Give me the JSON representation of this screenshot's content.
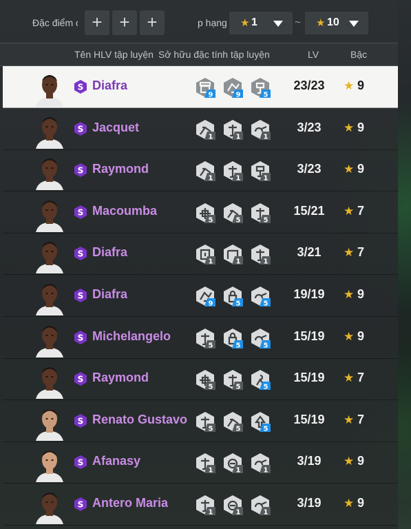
{
  "filter": {
    "trait_label": "Đặc điểm c",
    "rank_label": "p hạng",
    "min_rank": "1",
    "max_rank": "10",
    "separator": "~",
    "add_symbol": "+"
  },
  "columns": {
    "coach_name": "Tên HLV tập luyện",
    "owned_traits": "Sở hữu đặc tính tập luyện",
    "level": "LV",
    "grade": "Bậc"
  },
  "colors": {
    "accent_star": "#e7b428",
    "name_purple": "#c98ce6",
    "badge_blue": "#1e8fe6",
    "badge_gray": "#555a5d",
    "selected_row": "#f5f5f3"
  },
  "rows": [
    {
      "name": "Diafra",
      "level": "23/23",
      "grade": "9",
      "selected": true,
      "skills": [
        {
          "icon": "shield-trait-icon",
          "n": "9",
          "tier": "blue"
        },
        {
          "icon": "dribble-trait-icon",
          "n": "9",
          "tier": "blue"
        },
        {
          "icon": "goalkeeper-trait-icon",
          "n": "5",
          "tier": "blue"
        }
      ]
    },
    {
      "name": "Jacquet",
      "level": "3/23",
      "grade": "9",
      "skills": [
        {
          "icon": "tackle-trait-icon",
          "n": "1",
          "tier": "gray"
        },
        {
          "icon": "sprint-trait-icon",
          "n": "1",
          "tier": "gray"
        },
        {
          "icon": "pass-trait-icon",
          "n": "1",
          "tier": "gray"
        }
      ]
    },
    {
      "name": "Raymond",
      "level": "3/23",
      "grade": "9",
      "skills": [
        {
          "icon": "tackle-trait-icon",
          "n": "1",
          "tier": "gray"
        },
        {
          "icon": "sprint-trait-icon",
          "n": "1",
          "tier": "gray"
        },
        {
          "icon": "goalkeeper-trait-icon",
          "n": "1",
          "tier": "gray"
        }
      ]
    },
    {
      "name": "Macoumba",
      "level": "15/21",
      "grade": "7",
      "skills": [
        {
          "icon": "crosshair-trait-icon",
          "n": "5",
          "tier": "gray"
        },
        {
          "icon": "tackle-trait-icon",
          "n": "5",
          "tier": "gray"
        },
        {
          "icon": "sprint-trait-icon",
          "n": "5",
          "tier": "gray"
        }
      ]
    },
    {
      "name": "Diafra",
      "level": "3/21",
      "grade": "7",
      "skills": [
        {
          "icon": "ball-shield-trait-icon",
          "n": "1",
          "tier": "gray"
        },
        {
          "icon": "goal-trait-icon",
          "n": "1",
          "tier": "gray"
        },
        {
          "icon": "sprint-trait-icon",
          "n": "1",
          "tier": "gray"
        }
      ]
    },
    {
      "name": "Diafra",
      "level": "19/19",
      "grade": "9",
      "skills": [
        {
          "icon": "dribble-trait-icon",
          "n": "9",
          "tier": "blue"
        },
        {
          "icon": "lock-trait-icon",
          "n": "5",
          "tier": "blue"
        },
        {
          "icon": "pass-trait-icon",
          "n": "5",
          "tier": "blue"
        }
      ]
    },
    {
      "name": "Michelangelo",
      "level": "15/19",
      "grade": "9",
      "skills": [
        {
          "icon": "sprint-trait-icon",
          "n": "5",
          "tier": "gray"
        },
        {
          "icon": "lock-trait-icon",
          "n": "5",
          "tier": "blue"
        },
        {
          "icon": "pass-trait-icon",
          "n": "5",
          "tier": "blue"
        }
      ]
    },
    {
      "name": "Raymond",
      "level": "15/19",
      "grade": "7",
      "skills": [
        {
          "icon": "crosshair-trait-icon",
          "n": "5",
          "tier": "gray"
        },
        {
          "icon": "sprint-trait-icon",
          "n": "5",
          "tier": "gray"
        },
        {
          "icon": "person-trait-icon",
          "n": "5",
          "tier": "blue"
        }
      ]
    },
    {
      "name": "Renato Gustavo",
      "level": "15/19",
      "grade": "7",
      "skills": [
        {
          "icon": "sprint-trait-icon",
          "n": "5",
          "tier": "gray"
        },
        {
          "icon": "tackle-trait-icon",
          "n": "5",
          "tier": "gray"
        },
        {
          "icon": "arrow-up-trait-icon",
          "n": "5",
          "tier": "blue"
        }
      ]
    },
    {
      "name": "Afanasy",
      "level": "3/19",
      "grade": "9",
      "skills": [
        {
          "icon": "sprint-trait-icon",
          "n": "1",
          "tier": "gray"
        },
        {
          "icon": "ball-trait-icon",
          "n": "1",
          "tier": "gray"
        },
        {
          "icon": "pass-trait-icon",
          "n": "1",
          "tier": "gray"
        }
      ]
    },
    {
      "name": "Antero Maria",
      "level": "3/19",
      "grade": "9",
      "skills": [
        {
          "icon": "sprint-trait-icon",
          "n": "1",
          "tier": "gray"
        },
        {
          "icon": "ball-trait-icon",
          "n": "1",
          "tier": "gray"
        },
        {
          "icon": "pass-trait-icon",
          "n": "1",
          "tier": "gray"
        }
      ]
    }
  ]
}
